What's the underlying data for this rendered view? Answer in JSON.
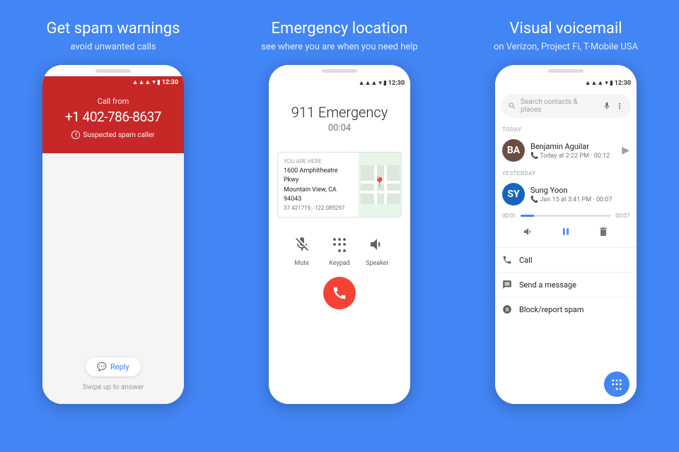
{
  "panels": [
    {
      "id": "spam",
      "title": "Get spam warnings",
      "subtitle": "avoid unwanted calls",
      "bgColor": "#4285F4",
      "phone": {
        "statusTime": "12:30",
        "callFrom": "Call from",
        "phoneNumber": "+1 402-786-8637",
        "spamWarning": "Suspected spam caller",
        "replyLabel": "Reply",
        "swipeText": "Swipe up to answer"
      }
    },
    {
      "id": "emergency",
      "title": "Emergency location",
      "subtitle": "see where you are when you need help",
      "bgColor": "#4285F4",
      "phone": {
        "statusTime": "12:30",
        "callerName": "911 Emergency",
        "callTimer": "00:04",
        "youAreHere": "YOU ARE HERE",
        "address1": "1600 Amphitheatre Pkwy",
        "address2": "Mountain View, CA 94043",
        "coords": "37.421719, -122.085297",
        "muteLabel": "Mute",
        "keypadLabel": "Keypad",
        "speakerLabel": "Speaker"
      }
    },
    {
      "id": "voicemail",
      "title": "Visual voicemail",
      "subtitle": "on Verizon, Project Fi, T-Mobile USA",
      "bgColor": "#4285F4",
      "phone": {
        "statusTime": "12:30",
        "searchPlaceholder": "Search contacts & places",
        "todayLabel": "TODAY",
        "yesterdayLabel": "YESTERDAY",
        "contact1": {
          "name": "Benjamin Aguilar",
          "meta": "Today at 2:22 PM · 00:12",
          "avatarColor": "#6D4C41",
          "initials": "BA"
        },
        "contact2": {
          "name": "Sung Yoon",
          "meta": "Jan 15 at 3:41 PM · 00:07",
          "avatarColor": "#1565C0",
          "initials": "SY"
        },
        "progressStart": "00:01",
        "progressEnd": "00:07",
        "progressPercent": 15,
        "callLabel": "Call",
        "messageLabel": "Send a message",
        "blockLabel": "Block/report spam"
      }
    }
  ]
}
